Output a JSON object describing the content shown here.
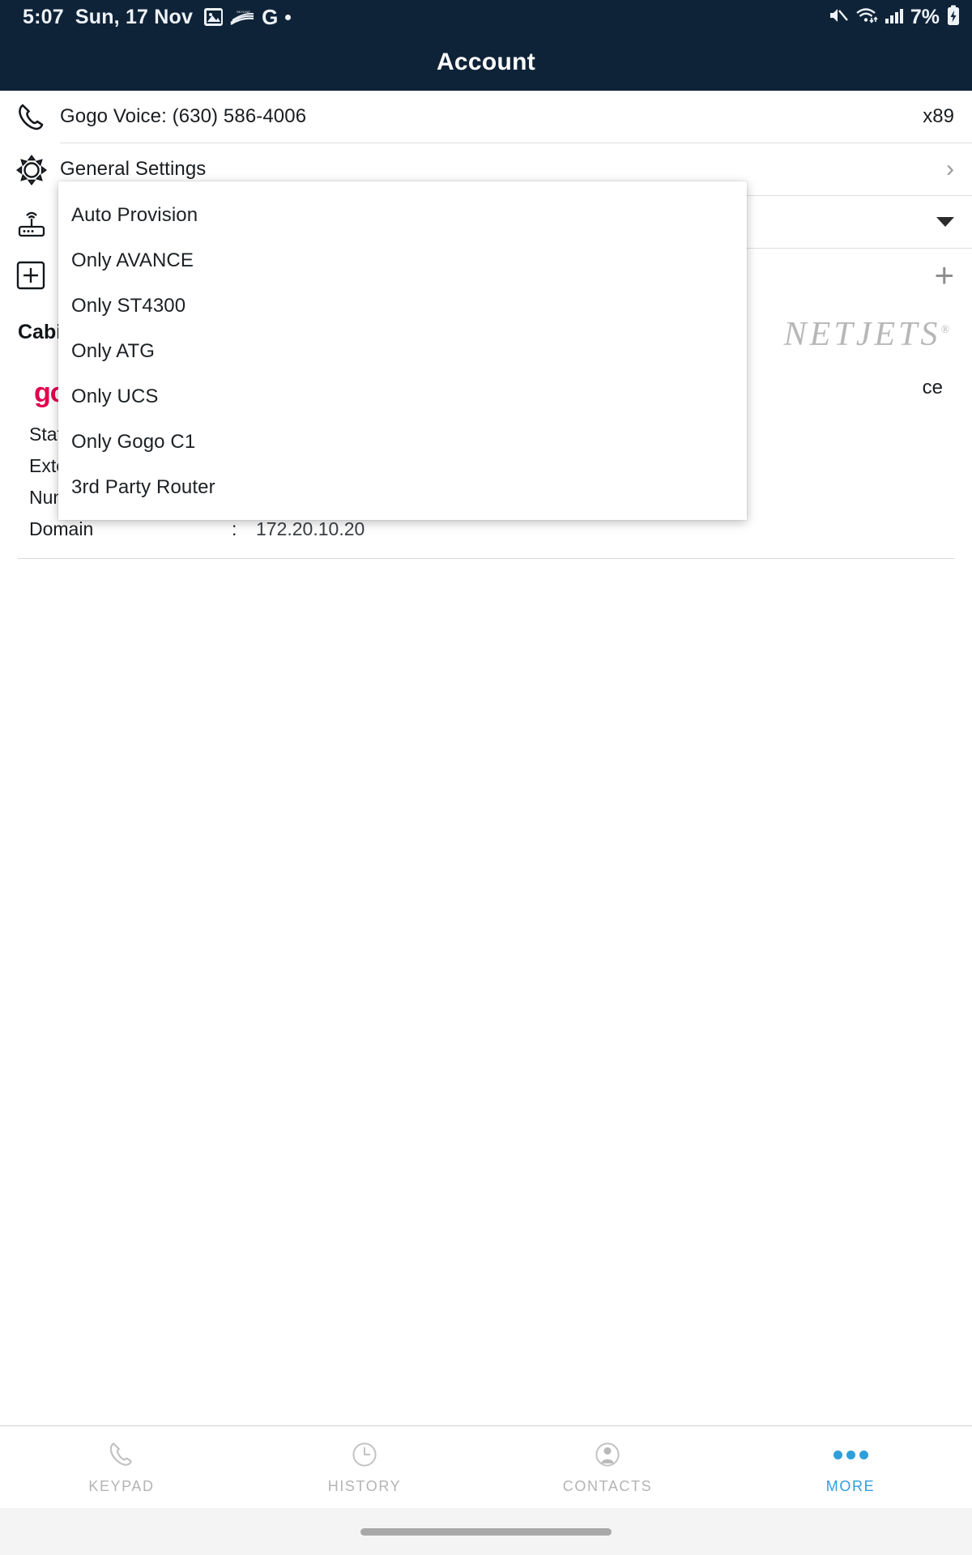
{
  "status_bar": {
    "time": "5:07",
    "date": "Sun, 17 Nov",
    "battery_percent": "7%",
    "left_icons": [
      "image-icon",
      "skyline-icon",
      "google-icon",
      "dot-icon"
    ],
    "right_icons": [
      "mute-icon",
      "wifi-icon",
      "cellular-signal-icon",
      "battery-charging-icon"
    ]
  },
  "header": {
    "title": "Account",
    "background_color": "#0f2338"
  },
  "rows": {
    "voice": {
      "label": "Gogo Voice: (630) 586-4006",
      "value": "x89",
      "icon": "phone-icon"
    },
    "general_settings": {
      "label": "General Settings",
      "icon": "gear-icon",
      "chevron": "›"
    },
    "router": {
      "label": "",
      "icon": "router-icon",
      "control": "caret-down-icon"
    },
    "add": {
      "label": "",
      "icon": "add-box-icon",
      "control": "plus-icon"
    }
  },
  "cabin_section": {
    "title": "Cabin",
    "logo_text": "gogo",
    "head_right": "ce",
    "details": [
      {
        "key": "Status",
        "sep": ":",
        "value": ""
      },
      {
        "key": "Extension",
        "sep": ":",
        "value": ""
      },
      {
        "key": "Number",
        "sep": ":",
        "value": ""
      },
      {
        "key": "Domain",
        "sep": ":",
        "value": "172.20.10.20"
      }
    ]
  },
  "dropdown": {
    "name": "provisioning-mode-dropdown",
    "items": [
      "Auto Provision",
      "Only AVANCE",
      "Only ST4300",
      "Only ATG",
      "Only UCS",
      "Only Gogo C1",
      "3rd Party Router"
    ]
  },
  "watermark": {
    "text": "NETJETS",
    "mark": "®"
  },
  "tab_bar": {
    "active_color": "#2f9fdb",
    "inactive_color": "#b4b4b4",
    "tabs": [
      {
        "label": "KEYPAD",
        "icon": "phone-icon",
        "active": false
      },
      {
        "label": "HISTORY",
        "icon": "clock-icon",
        "active": false
      },
      {
        "label": "CONTACTS",
        "icon": "person-icon",
        "active": false
      },
      {
        "label": "MORE",
        "icon": "ellipsis-icon",
        "active": true
      }
    ]
  }
}
